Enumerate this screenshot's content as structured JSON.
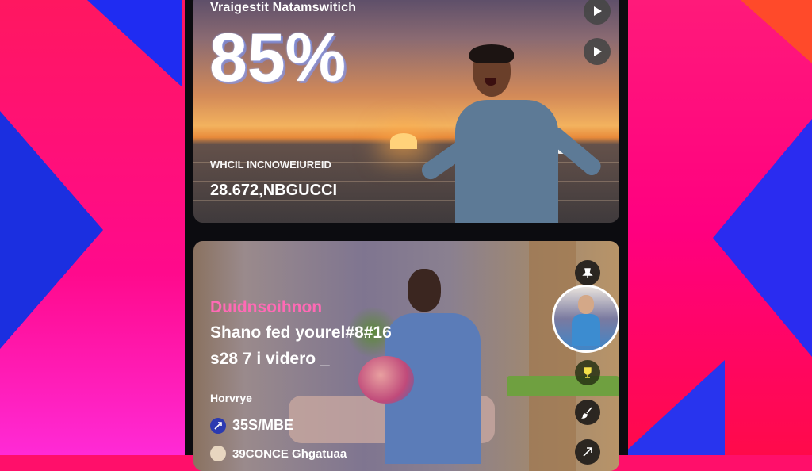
{
  "top_card": {
    "title": "Vraigestit Natamswitich",
    "big_stat": "85%",
    "caption_small": "WHCIL INCNOWEIUREID",
    "caption_meta": "28.672,NBGUCCI"
  },
  "bottom_card": {
    "overlay_pink": "Duidnsoihnon",
    "overlay_line1": "Shano fed yourel#8#16",
    "overlay_line2": "s28 7 i videro _",
    "section_label": "Horvrye",
    "stat_1": "35S/MBE",
    "stat_2": "39CONCE Ghgatuaa"
  },
  "icons": {
    "play": "play-icon",
    "pin": "pin-icon",
    "trophy": "trophy-icon",
    "brush": "brush-icon",
    "share": "share-icon"
  },
  "colors": {
    "accent_pink": "#ff6ab5",
    "background_pink": "#ff0f6a",
    "background_blue": "#1f2cf2"
  }
}
